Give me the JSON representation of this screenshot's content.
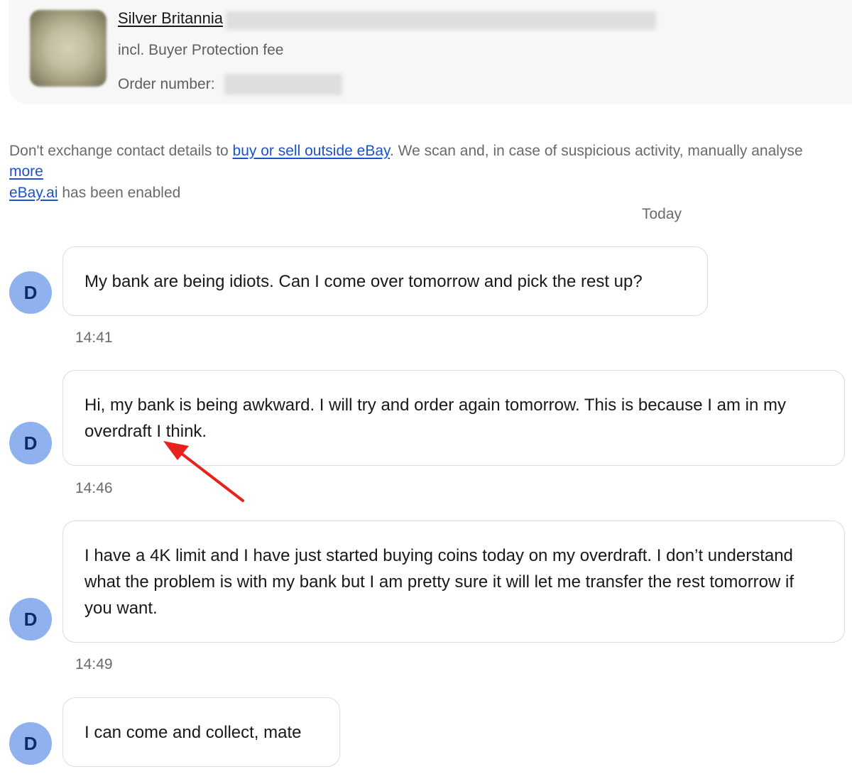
{
  "order": {
    "item_title": "Silver Britannia",
    "fee_note": "incl. Buyer Protection fee",
    "order_number_label": "Order number:"
  },
  "notices": {
    "warning_prefix": "Don't exchange contact details to ",
    "warning_link": "buy or sell outside eBay",
    "warning_suffix": ". We scan and, in case of suspicious activity, manually analyse",
    "more_link": "more",
    "ai_link": "eBay.ai",
    "ai_suffix": " has been enabled"
  },
  "conversation": {
    "day_label": "Today",
    "messages": [
      {
        "avatar": "D",
        "text": "My bank are being idiots. Can I come over tomorrow and pick the rest up?",
        "time": "14:41"
      },
      {
        "avatar": "D",
        "text": "Hi, my bank is being awkward. I will try and order again tomorrow. This is because I am in my overdraft I think.",
        "time": "14:46"
      },
      {
        "avatar": "D",
        "text": "I have a 4K limit and I have just started buying coins today on my overdraft. I don’t understand what the problem is with my bank but I am pretty sure it will let me transfer the rest tomorrow if you want.",
        "time": "14:49"
      },
      {
        "avatar": "D",
        "text": "I can come and collect, mate",
        "time": ""
      }
    ]
  },
  "annotation": {
    "arrow_color": "#e8211c"
  },
  "icons": {
    "item_image": "coin-thumbnail",
    "annotation": "red-arrow-icon"
  }
}
